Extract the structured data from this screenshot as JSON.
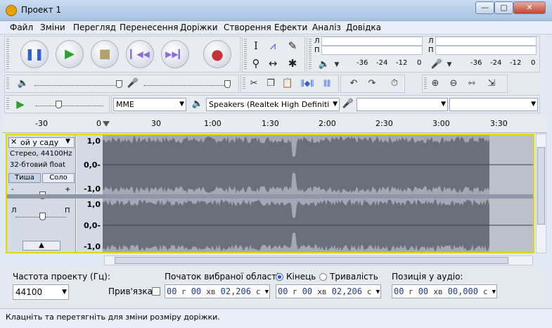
{
  "window": {
    "title": "Проект 1",
    "controls": {
      "minimize": "—",
      "maximize": "▢",
      "close": "✕"
    }
  },
  "menu": [
    "Файл",
    "Зміни",
    "Перегляд",
    "Перенесення",
    "Доріжки",
    "Створення",
    "Ефекти",
    "Аналіз",
    "Довідка"
  ],
  "meters": {
    "play_channels": [
      "Л",
      "П"
    ],
    "rec_channels": [
      "Л",
      "П"
    ],
    "scale": [
      "-36",
      "-24",
      "-12",
      "0"
    ]
  },
  "device": {
    "host": "MME",
    "output": "Speakers (Realtek High Definiti",
    "input": "",
    "channels": ""
  },
  "ruler": {
    "ticks": [
      "-30",
      "0",
      "30",
      "1:00",
      "1:30",
      "2:00",
      "2:30",
      "3:00",
      "3:30"
    ]
  },
  "track": {
    "name": "ой у саду",
    "info_line1": "Стерео, 44100Hz",
    "info_line2": "32-бтовий float",
    "mute_label": "Тиша",
    "solo_label": "Соло",
    "gain_minus": "-",
    "gain_plus": "+",
    "pan_left": "Л",
    "pan_right": "П",
    "scale_top": [
      "1,0",
      "0,0-",
      "-1,0"
    ],
    "scale_bottom": [
      "1,0",
      "0,0-",
      "-1,0"
    ]
  },
  "bottom": {
    "rate_label": "Частота проекту (Гц):",
    "rate_value": "44100",
    "snap_label": "Прив'язка",
    "sel_start_label": "Початок вибраної області:",
    "end_label": "Кінець",
    "length_label": "Тривалість",
    "position_label": "Позиція у аудіо:",
    "start_time": {
      "h": "00",
      "hu": "г",
      "m": "00",
      "mu": "хв",
      "s": "02,206",
      "su": "с"
    },
    "end_time": {
      "h": "00",
      "hu": "г",
      "m": "00",
      "mu": "хв",
      "s": "02,206",
      "su": "с"
    },
    "audio_pos": {
      "h": "00",
      "hu": "г",
      "m": "00",
      "mu": "хв",
      "s": "00,000",
      "su": "с"
    }
  },
  "status": "Клацніть та перетягніть для зміни розміру доріжки.",
  "colors": {
    "selection_border": "#e0d800",
    "waveform": "#6b6f78",
    "accent_blue": "#1f3b8f"
  }
}
